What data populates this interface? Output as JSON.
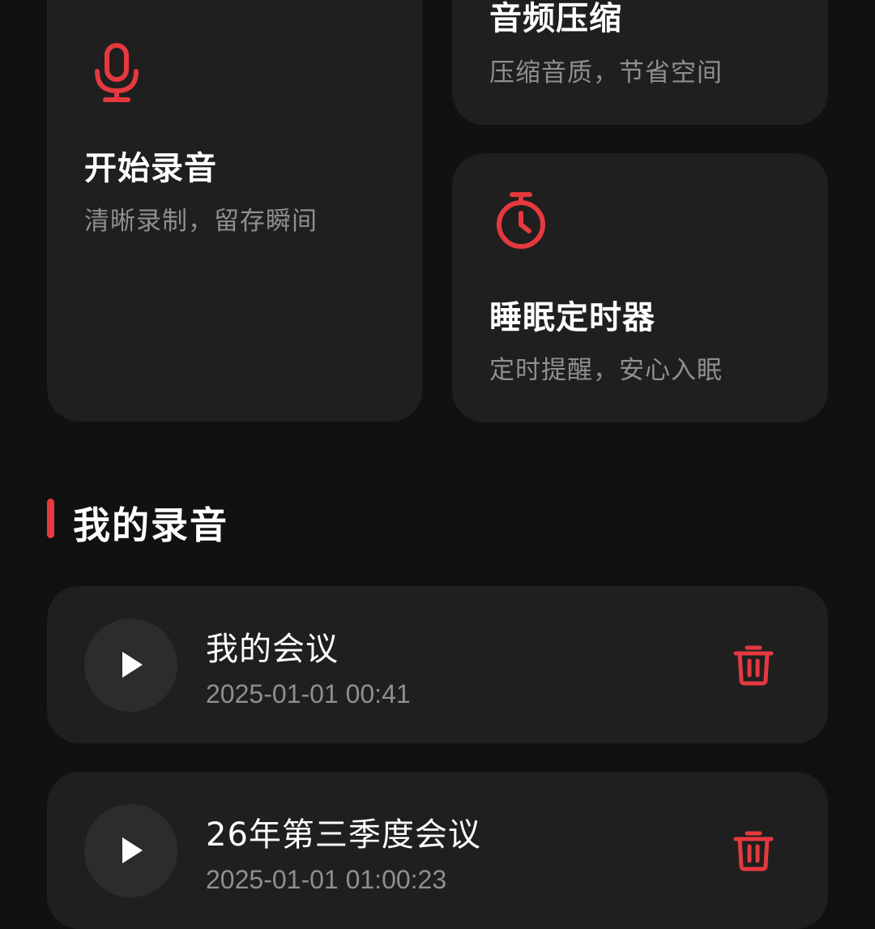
{
  "features": [
    {
      "title": "开始录音",
      "desc": "清晰录制，留存瞬间",
      "icon": "microphone-icon"
    },
    {
      "title": "音频压缩",
      "desc": "压缩音质，节省空间",
      "icon": ""
    },
    {
      "title": "睡眠定时器",
      "desc": "定时提醒，安心入眠",
      "icon": "stopwatch-icon"
    }
  ],
  "section": {
    "title": "我的录音"
  },
  "recordings": [
    {
      "title": "我的会议",
      "time": "2025-01-01 00:41"
    },
    {
      "title": "26年第三季度会议",
      "time": "2025-01-01 01:00:23"
    }
  ],
  "colors": {
    "background": "#111111",
    "card": "#1f1f1f",
    "accent": "#e5393f",
    "secondary_text": "#8e8e93",
    "play_button": "#2c2c2e"
  }
}
